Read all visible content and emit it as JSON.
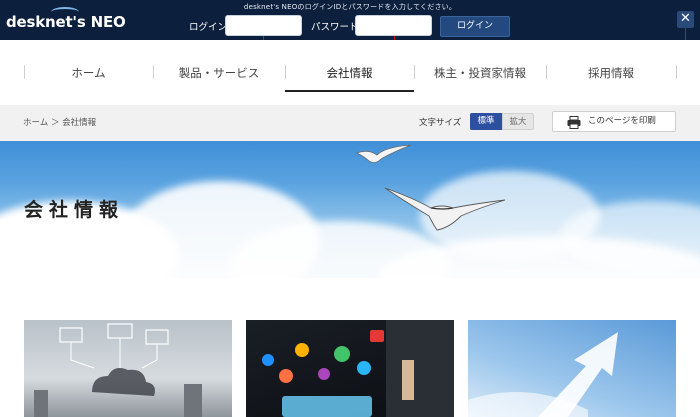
{
  "login_bar": {
    "notice": "desknet's NEOのログインIDとパスワードを入力してください。",
    "logo_text": "desknet's",
    "logo_neo": "NEO",
    "login_label": "ログイン",
    "password_label": "パスワード",
    "login_value": "",
    "password_value": "",
    "login_button": "ログイン",
    "close_glyph": "✕",
    "markers": [
      "1",
      "2",
      "3"
    ]
  },
  "nav": {
    "items": [
      {
        "label": "ホーム"
      },
      {
        "label": "製品・サービス"
      },
      {
        "label": "会社情報"
      },
      {
        "label": "株主・投資家情報"
      },
      {
        "label": "採用情報"
      }
    ],
    "active_index": 2
  },
  "breadcrumb": {
    "text": "ホーム ＞ 会社情報"
  },
  "font_size": {
    "label": "文字サイズ",
    "standard": "標準",
    "large": "拡大"
  },
  "print": {
    "label": "このページを印刷",
    "icon": "printer-icon"
  },
  "hero": {
    "title": "会社情報"
  },
  "colors": {
    "topbar": "#0c1f3c",
    "accent": "#2c4fa0",
    "marker": "#c8161d"
  }
}
